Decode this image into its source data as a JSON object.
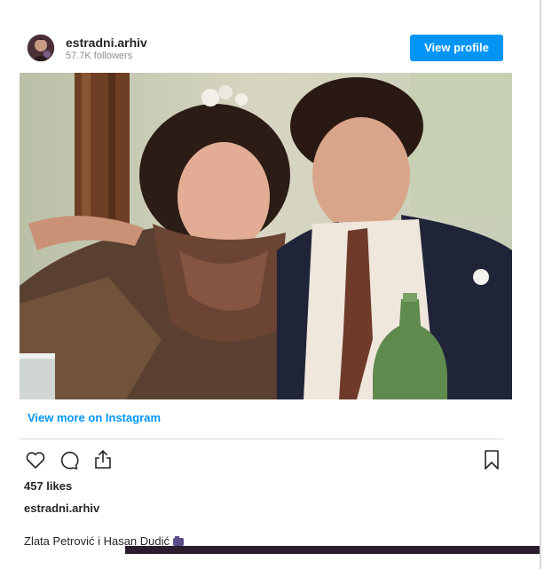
{
  "post": {
    "username": "estradni.arhiv",
    "followers": "57.7K followers",
    "view_profile_label": "View profile",
    "view_more_label": "View more on Instagram",
    "likes": "457 likes",
    "caption_username": "estradni.arhiv",
    "caption_text": "Zlata Petrović i Hasan Dudić"
  },
  "icons": {
    "like": "heart-icon",
    "comment": "comment-icon",
    "share": "share-icon",
    "save": "bookmark-icon",
    "caption_emoji": "camera-emoji-icon"
  },
  "colors": {
    "accent": "#0095f6",
    "text": "#262626",
    "muted": "#8e8e8e",
    "divider": "#dbdbdb"
  }
}
